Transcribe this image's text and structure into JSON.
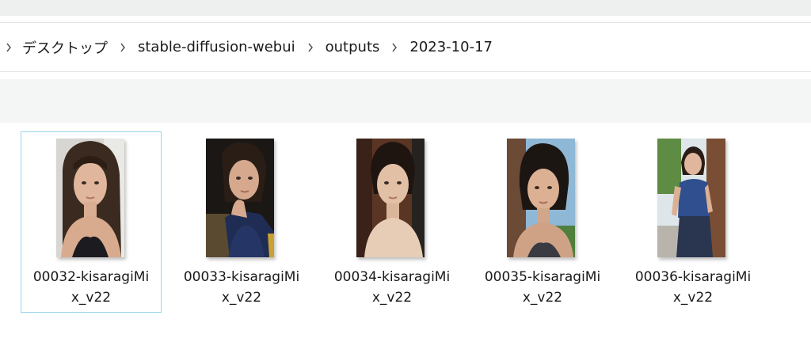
{
  "breadcrumb": {
    "items": [
      "デスクトップ",
      "stable-diffusion-webui",
      "outputs",
      "2023-10-17"
    ]
  },
  "files": [
    {
      "name_line1": "00032-kisaragiMi",
      "name_line2": "x_v22",
      "selected": true
    },
    {
      "name_line1": "00033-kisaragiMi",
      "name_line2": "x_v22",
      "selected": false
    },
    {
      "name_line1": "00034-kisaragiMi",
      "name_line2": "x_v22",
      "selected": false
    },
    {
      "name_line1": "00035-kisaragiMi",
      "name_line2": "x_v22",
      "selected": false
    },
    {
      "name_line1": "00036-kisaragiMi",
      "name_line2": "x_v22",
      "selected": false
    }
  ],
  "colors": {
    "selection_border": "#99d5ee",
    "toolbar_band": "#f4f6f6"
  }
}
